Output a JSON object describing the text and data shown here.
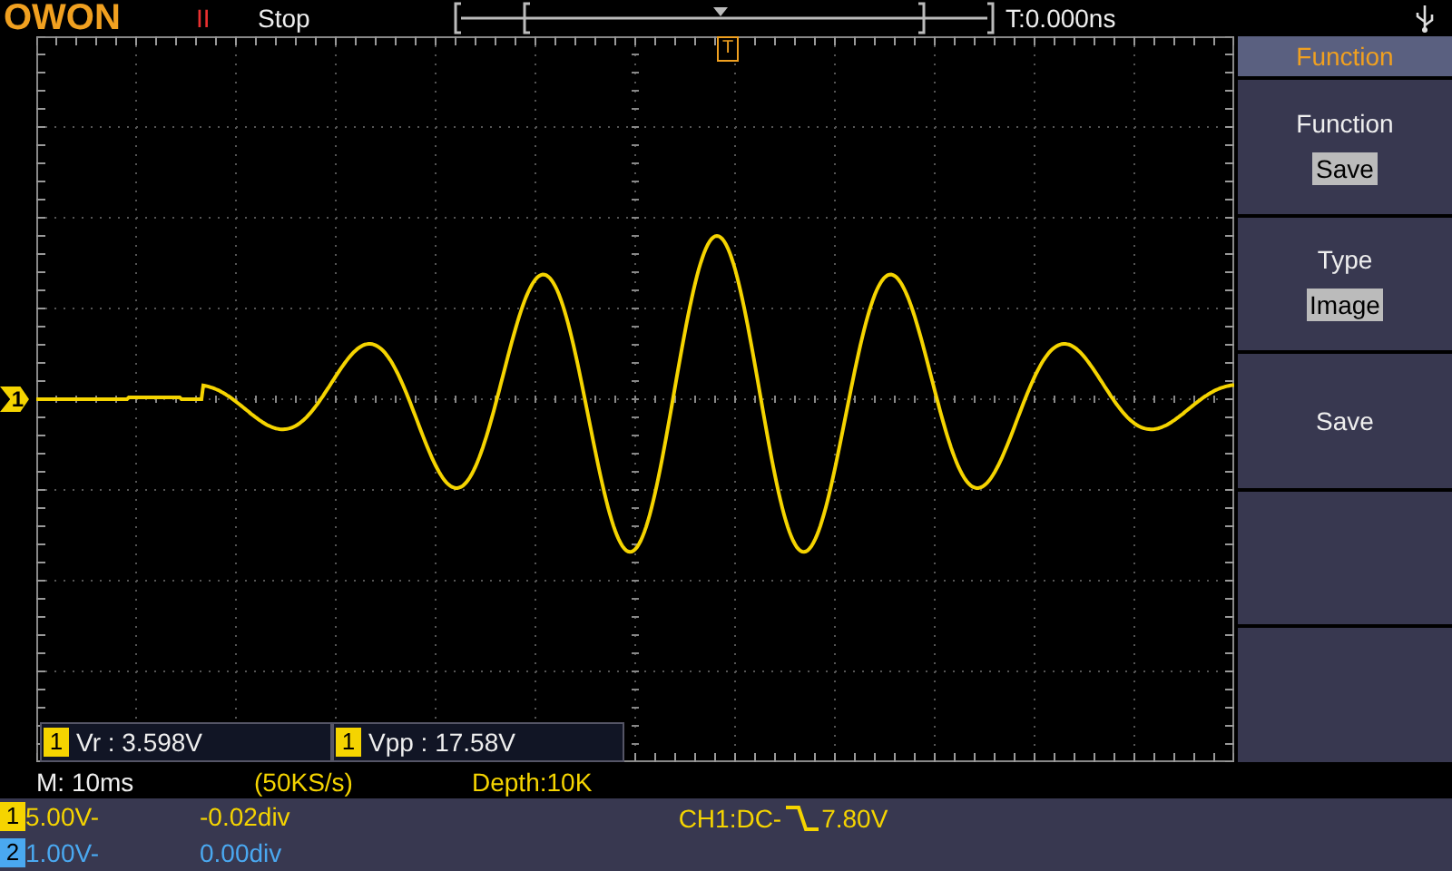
{
  "header": {
    "logo": "OWON",
    "run_indicator": "II",
    "run_state": "Stop",
    "time_offset": "T:0.000ns"
  },
  "screen": {
    "trigger_marker": "T",
    "channel_marker": "1",
    "measurements": [
      {
        "channel": "1",
        "text": "Vr : 3.598V"
      },
      {
        "channel": "1",
        "text": "Vpp : 17.58V"
      }
    ]
  },
  "menu": {
    "title": "Function",
    "items": [
      {
        "kind": "option",
        "label": "Function",
        "value": "Save"
      },
      {
        "kind": "option",
        "label": "Type",
        "value": "Image"
      },
      {
        "kind": "action",
        "label": "Save"
      },
      {
        "kind": "empty"
      },
      {
        "kind": "empty"
      }
    ]
  },
  "timebase": {
    "scale": "M: 10ms",
    "sample_rate": "(50KS/s)",
    "depth": "Depth:10K"
  },
  "channels": [
    {
      "number": "1",
      "color": "#f5d400",
      "volts": "5.00V-",
      "offset": "-0.02div"
    },
    {
      "number": "2",
      "color": "#4aa8f0",
      "volts": "1.00V-",
      "offset": "0.00div"
    }
  ],
  "trigger": {
    "source": "CH1:DC-",
    "level": "7.80V"
  }
}
